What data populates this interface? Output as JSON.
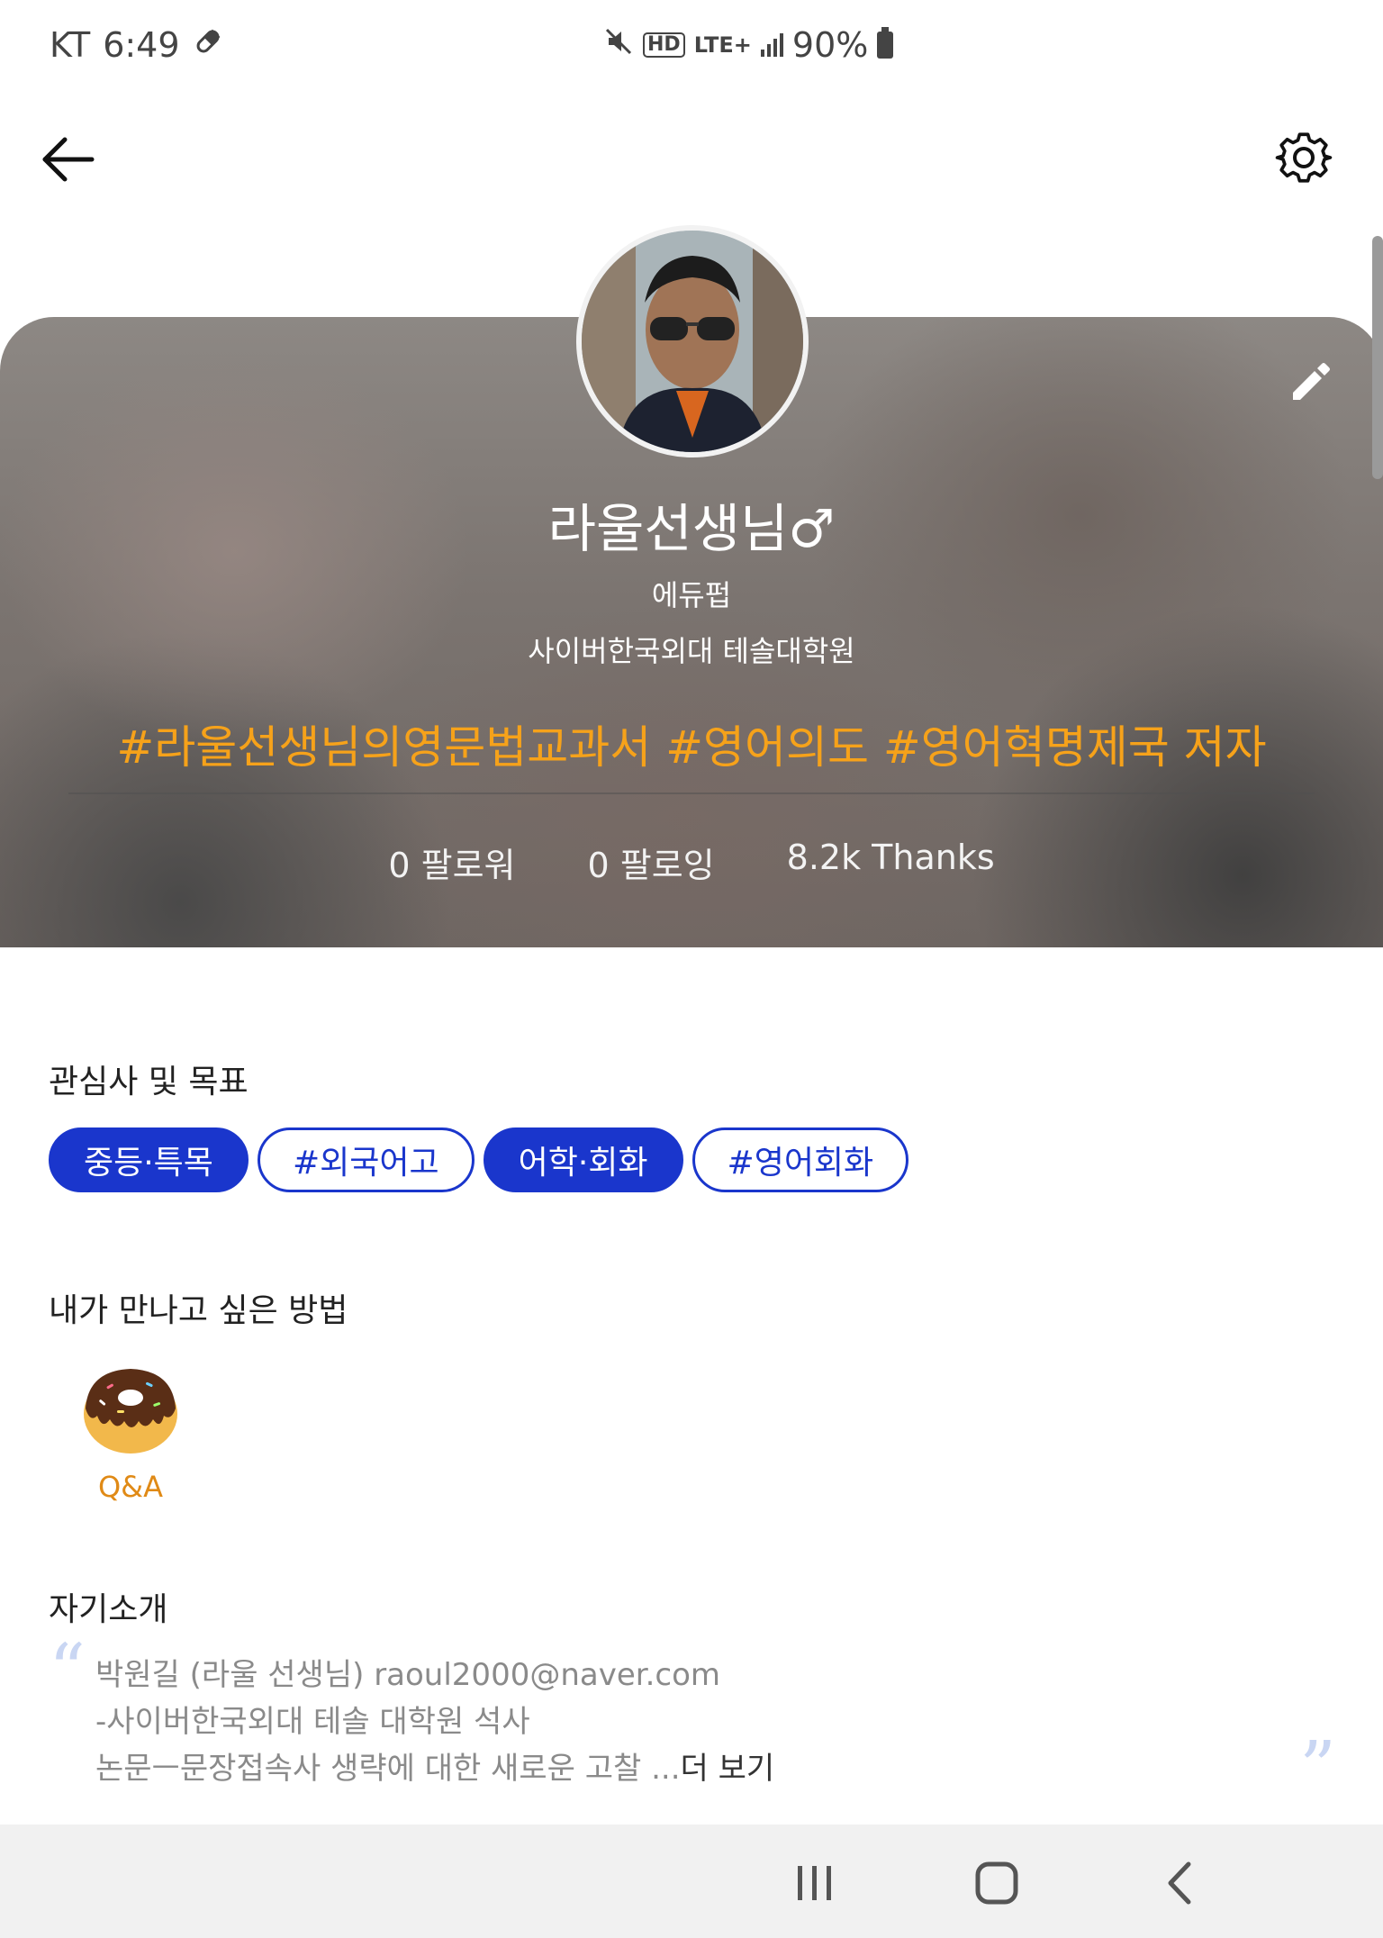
{
  "status_bar": {
    "carrier": "KT",
    "time": "6:49",
    "hd_label": "HD",
    "network": "LTE+",
    "battery": "90%"
  },
  "profile": {
    "name": "라울선생님♂",
    "org": "에듀펍",
    "school": "사이버한국외대 테솔대학원",
    "hashtags": "#라울선생님의영문법교과서 #영어의도 #영어혁명제국 저자",
    "stats": [
      {
        "label": "0 팔로워"
      },
      {
        "label": "0 팔로잉"
      },
      {
        "label": "8.2k Thanks"
      }
    ]
  },
  "interests": {
    "title": "관심사 및 목표",
    "chips": [
      {
        "label": "중등·특목",
        "style": "filled"
      },
      {
        "label": "#외국어고",
        "style": "outline"
      },
      {
        "label": "어학·회화",
        "style": "filled"
      },
      {
        "label": "#영어회화",
        "style": "outline"
      }
    ]
  },
  "meet": {
    "title": "내가 만나고 싶은 방법",
    "items": [
      {
        "label": "Q&A",
        "icon": "donut-icon"
      }
    ]
  },
  "intro": {
    "title": "자기소개",
    "lines": [
      "박원길 (라울 선생님)  raoul2000@naver.com",
      "-사이버한국외대 테솔 대학원 석사",
      "논문ㅡ문장접속사 생략에 대한 새로운 고찰 ..."
    ],
    "more_label": "더 보기"
  },
  "colors": {
    "accent_blue": "#1a36cc",
    "hashtag_orange": "#f6a21a",
    "qa_orange": "#e08a16"
  }
}
